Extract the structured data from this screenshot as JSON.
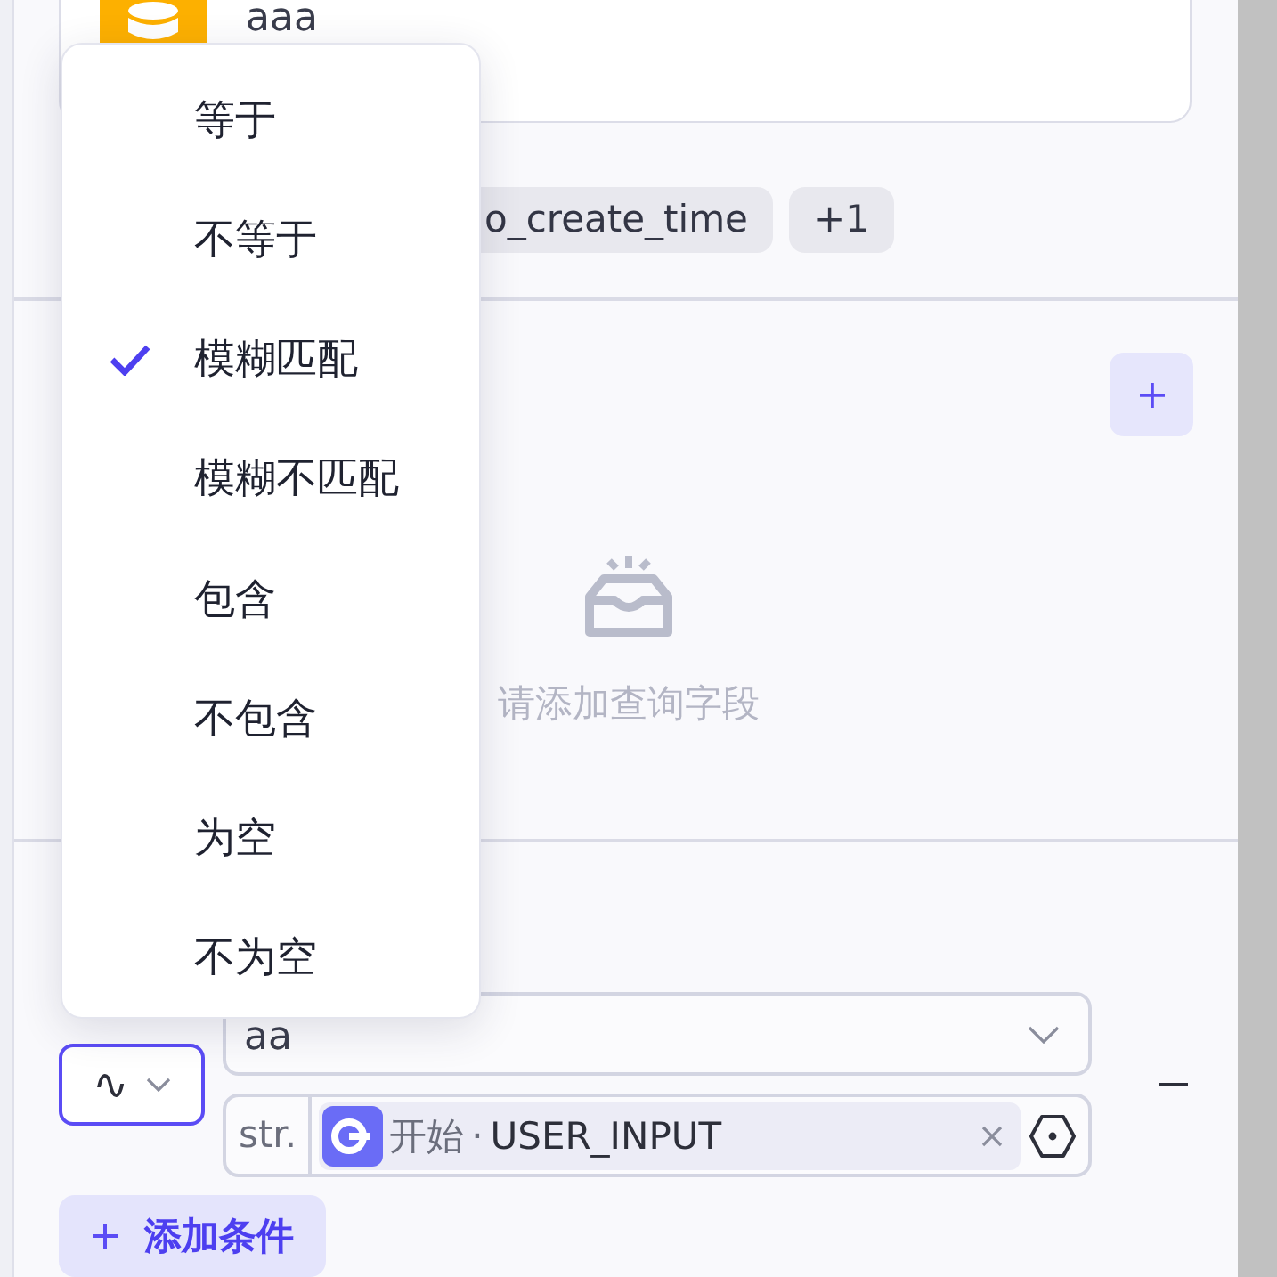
{
  "card": {
    "title": "aaa"
  },
  "chips": [
    "o_create_time",
    "+1"
  ],
  "query_fields": {
    "empty_text": "请添加查询字段"
  },
  "condition": {
    "operator_symbol": "∿",
    "field": "aa",
    "value": {
      "type_label": "str.",
      "source": "开始",
      "separator": "·",
      "variable": "USER_INPUT"
    }
  },
  "add_condition": {
    "label": "添加条件"
  },
  "operator_menu": {
    "items": [
      {
        "label": "等于",
        "selected": false
      },
      {
        "label": "不等于",
        "selected": false
      },
      {
        "label": "模糊匹配",
        "selected": true
      },
      {
        "label": "模糊不匹配",
        "selected": false
      },
      {
        "label": "包含",
        "selected": false
      },
      {
        "label": "不包含",
        "selected": false
      },
      {
        "label": "为空",
        "selected": false
      },
      {
        "label": "不为空",
        "selected": false
      }
    ]
  }
}
